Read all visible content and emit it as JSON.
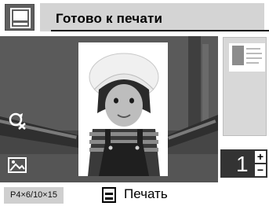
{
  "header": {
    "title": "Готово к печати",
    "mode_icon": "layout-thumbnail-icon"
  },
  "photo": {
    "description_icon": "child-photo"
  },
  "tools": {
    "rotate_icon": "rotate-icon",
    "adjust_icon": "image-adjust-icon"
  },
  "thumbnail": {
    "icon": "layout-preview"
  },
  "quantity": {
    "value": "1",
    "plus": "+",
    "minus": "−"
  },
  "footer": {
    "paper_size": "P4×6/10×15",
    "print_label": "Печать",
    "print_icon": "print-icon"
  }
}
